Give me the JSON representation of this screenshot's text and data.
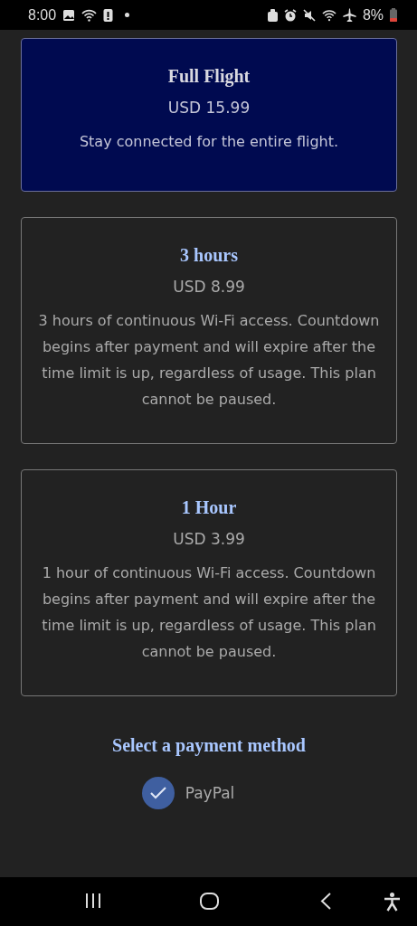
{
  "status_bar": {
    "time": "8:00",
    "battery": "8%"
  },
  "plans": [
    {
      "title": "Full Flight",
      "price": "USD 15.99",
      "description": "Stay connected for the entire flight.",
      "selected": true
    },
    {
      "title": "3 hours",
      "price": "USD 8.99",
      "description": "3 hours of continuous Wi-Fi access. Countdown begins after payment and will expire after the time limit is up, regardless of usage. This plan cannot be paused.",
      "selected": false
    },
    {
      "title": "1 Hour",
      "price": "USD 3.99",
      "description": "1 hour of continuous Wi-Fi access. Countdown begins after payment and will expire after the time limit is up, regardless of usage. This plan cannot be paused.",
      "selected": false
    }
  ],
  "payment": {
    "heading": "Select a payment method",
    "methods": [
      {
        "label": "PayPal",
        "selected": true
      }
    ]
  }
}
